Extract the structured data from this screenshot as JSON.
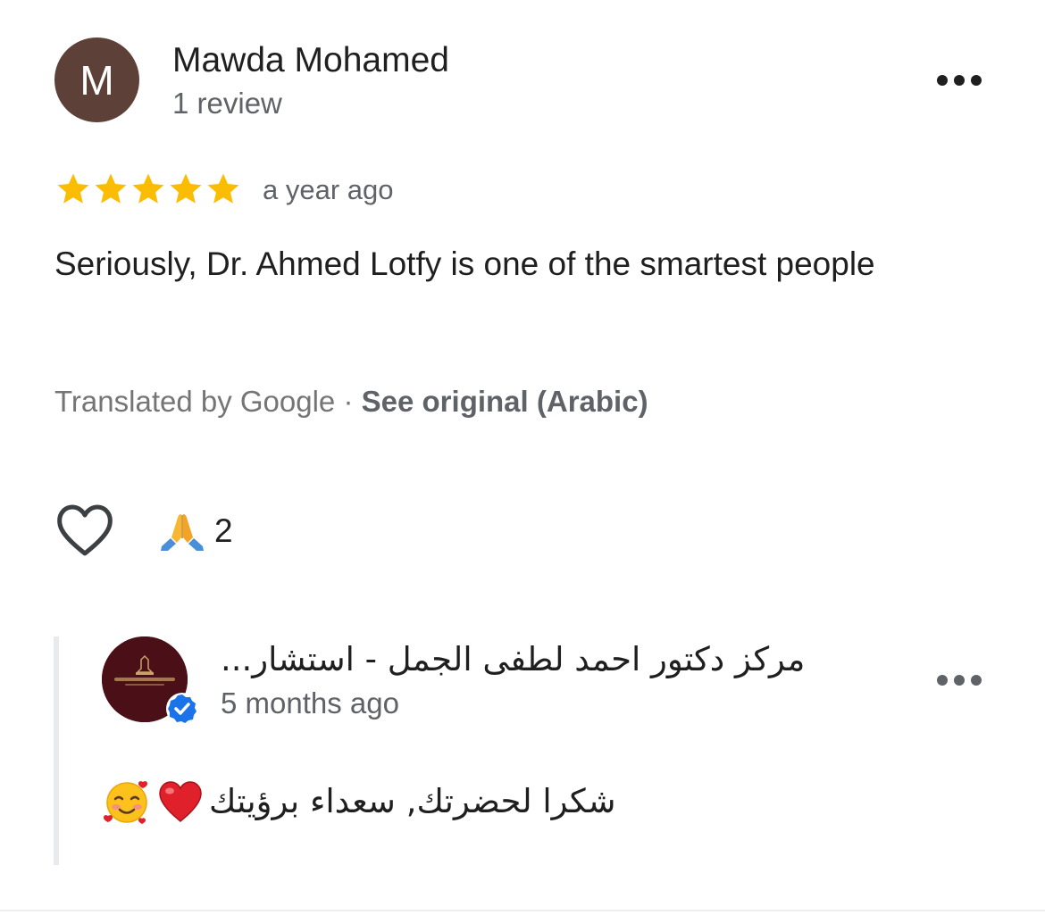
{
  "review": {
    "avatar_letter": "M",
    "avatar_color": "#5d4037",
    "reviewer_name": "Mawda Mohamed",
    "review_count": "1 review",
    "rating": 5,
    "rating_max": 5,
    "star_color": "#fbbc04",
    "time_ago": "a year ago",
    "text": "Seriously, Dr. Ahmed Lotfy is one of the smartest people",
    "translated_label": "Translated by Google",
    "separator": "·",
    "see_original": "See original (Arabic)",
    "more_icon": "more-horizontal-icon"
  },
  "reactions": {
    "like_icon": "heart-outline-icon",
    "reaction_icon": "folded-hands-emoji",
    "reaction_count": "2"
  },
  "owner_reply": {
    "name": "مركز دكتور احمد لطفى الجمل - استشار...",
    "avatar_color": "#4a0f17",
    "verified_icon": "verified-badge-icon",
    "verified_color": "#1a73e8",
    "time_ago": "5 months ago",
    "text": "شكرا لحضرتك, سعداء برؤيتك",
    "emojis": [
      "red-heart-emoji",
      "smiling-face-with-hearts-emoji"
    ],
    "more_icon": "more-horizontal-icon"
  }
}
